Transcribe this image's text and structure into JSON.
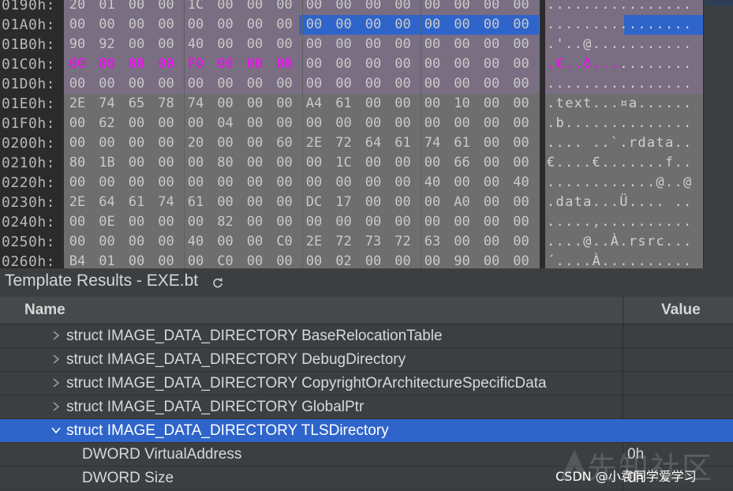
{
  "hex": {
    "rows": [
      {
        "addr": "0190h:",
        "bytes": [
          "20",
          "01",
          "00",
          "00",
          "1C",
          "00",
          "00",
          "00",
          "00",
          "00",
          "00",
          "00",
          "00",
          "00",
          "00",
          "00"
        ],
        "ascii": "................",
        "hl_bytes": [],
        "hl_ascii": 0,
        "bg": "#2b2b2b"
      },
      {
        "addr": "01A0h:",
        "bytes": [
          "00",
          "00",
          "00",
          "00",
          "00",
          "00",
          "00",
          "00",
          "00",
          "00",
          "00",
          "00",
          "00",
          "00",
          "00",
          "00"
        ],
        "ascii": "................",
        "hl_bytes": [
          8,
          9,
          10,
          11,
          12,
          13,
          14,
          15
        ],
        "hl_ascii": 8,
        "bg": "#7a6e82"
      },
      {
        "addr": "01B0h:",
        "bytes": [
          "90",
          "92",
          "00",
          "00",
          "40",
          "00",
          "00",
          "00",
          "00",
          "00",
          "00",
          "00",
          "00",
          "00",
          "00",
          "00"
        ],
        "ascii": ".'..@...........",
        "hl_bytes": [],
        "hl_ascii": 0,
        "bg": "#7a6e82"
      },
      {
        "addr": "01C0h:",
        "bytes": [
          "00",
          "80",
          "00",
          "00",
          "F0",
          "00",
          "00",
          "00",
          "00",
          "00",
          "00",
          "00",
          "00",
          "00",
          "00",
          "00"
        ],
        "ascii": ".€..ð...........",
        "hl_bytes": [],
        "hl_ascii": 0,
        "bg": "#7a6e82",
        "magenta": [
          0,
          1,
          2,
          3,
          4,
          5,
          6,
          7
        ],
        "magenta_ascii": 8
      },
      {
        "addr": "01D0h:",
        "bytes": [
          "00",
          "00",
          "00",
          "00",
          "00",
          "00",
          "00",
          "00",
          "00",
          "00",
          "00",
          "00",
          "00",
          "00",
          "00",
          "00"
        ],
        "ascii": "................",
        "hl_bytes": [],
        "hl_ascii": 0,
        "bg": "#7a6e82"
      },
      {
        "addr": "01E0h:",
        "bytes": [
          "2E",
          "74",
          "65",
          "78",
          "74",
          "00",
          "00",
          "00",
          "A4",
          "61",
          "00",
          "00",
          "00",
          "10",
          "00",
          "00"
        ],
        "ascii": ".text...¤a......",
        "hl_bytes": [],
        "hl_ascii": 0,
        "bg": "#6e6e6e"
      },
      {
        "addr": "01F0h:",
        "bytes": [
          "00",
          "62",
          "00",
          "00",
          "00",
          "04",
          "00",
          "00",
          "00",
          "00",
          "00",
          "00",
          "00",
          "00",
          "00",
          "00"
        ],
        "ascii": ".b..............",
        "hl_bytes": [],
        "hl_ascii": 0,
        "bg": "#6e6e6e"
      },
      {
        "addr": "0200h:",
        "bytes": [
          "00",
          "00",
          "00",
          "00",
          "20",
          "00",
          "00",
          "60",
          "2E",
          "72",
          "64",
          "61",
          "74",
          "61",
          "00",
          "00"
        ],
        "ascii": ".... ..`.rdata..",
        "hl_bytes": [],
        "hl_ascii": 0,
        "bg": "#6e6e6e"
      },
      {
        "addr": "0210h:",
        "bytes": [
          "80",
          "1B",
          "00",
          "00",
          "00",
          "80",
          "00",
          "00",
          "00",
          "1C",
          "00",
          "00",
          "00",
          "66",
          "00",
          "00"
        ],
        "ascii": "€....€.......f..",
        "hl_bytes": [],
        "hl_ascii": 0,
        "bg": "#6e6e6e"
      },
      {
        "addr": "0220h:",
        "bytes": [
          "00",
          "00",
          "00",
          "00",
          "00",
          "00",
          "00",
          "00",
          "00",
          "00",
          "00",
          "00",
          "40",
          "00",
          "00",
          "40"
        ],
        "ascii": "............@..@",
        "hl_bytes": [],
        "hl_ascii": 0,
        "bg": "#6e6e6e"
      },
      {
        "addr": "0230h:",
        "bytes": [
          "2E",
          "64",
          "61",
          "74",
          "61",
          "00",
          "00",
          "00",
          "DC",
          "17",
          "00",
          "00",
          "00",
          "A0",
          "00",
          "00"
        ],
        "ascii": ".data...Ü.... ..",
        "hl_bytes": [],
        "hl_ascii": 0,
        "bg": "#6e6e6e"
      },
      {
        "addr": "0240h:",
        "bytes": [
          "00",
          "0E",
          "00",
          "00",
          "00",
          "82",
          "00",
          "00",
          "00",
          "00",
          "00",
          "00",
          "00",
          "00",
          "00",
          "00"
        ],
        "ascii": ".....,..........",
        "hl_bytes": [],
        "hl_ascii": 0,
        "bg": "#6e6e6e"
      },
      {
        "addr": "0250h:",
        "bytes": [
          "00",
          "00",
          "00",
          "00",
          "40",
          "00",
          "00",
          "C0",
          "2E",
          "72",
          "73",
          "72",
          "63",
          "00",
          "00",
          "00"
        ],
        "ascii": "....@..À.rsrc...",
        "hl_bytes": [],
        "hl_ascii": 0,
        "bg": "#6e6e6e"
      },
      {
        "addr": "0260h:",
        "bytes": [
          "B4",
          "01",
          "00",
          "00",
          "00",
          "C0",
          "00",
          "00",
          "00",
          "02",
          "00",
          "00",
          "00",
          "90",
          "00",
          "00"
        ],
        "ascii": "´....À..........",
        "hl_bytes": [],
        "hl_ascii": 0,
        "bg": "#6e6e6e"
      }
    ],
    "colors": {
      "selection": "#2f65ca",
      "magenta": "#ff00ff",
      "struct_bg": "#7a6e82",
      "gray_bg": "#6e6e6e"
    }
  },
  "template_results": {
    "title": "Template Results - EXE.bt",
    "refresh_icon": "refresh-icon",
    "columns": {
      "name": "Name",
      "value": "Value"
    },
    "rows": [
      {
        "label": "struct IMAGE_DATA_DIRECTORY BaseRelocationTable",
        "value": "",
        "expanded": false,
        "indent": 1,
        "selected": false
      },
      {
        "label": "struct IMAGE_DATA_DIRECTORY DebugDirectory",
        "value": "",
        "expanded": false,
        "indent": 1,
        "selected": false
      },
      {
        "label": "struct IMAGE_DATA_DIRECTORY CopyrightOrArchitectureSpecificData",
        "value": "",
        "expanded": false,
        "indent": 1,
        "selected": false
      },
      {
        "label": "struct IMAGE_DATA_DIRECTORY GlobalPtr",
        "value": "",
        "expanded": false,
        "indent": 1,
        "selected": false
      },
      {
        "label": "struct IMAGE_DATA_DIRECTORY TLSDirectory",
        "value": "",
        "expanded": true,
        "indent": 1,
        "selected": true
      },
      {
        "label": "DWORD VirtualAddress",
        "value": "0h",
        "expanded": null,
        "indent": 2,
        "selected": false
      },
      {
        "label": "DWORD Size",
        "value": "0h",
        "expanded": null,
        "indent": 2,
        "selected": false
      }
    ]
  },
  "watermark": {
    "big": "先知社区",
    "small": "CSDN @小袁同学爱学习"
  }
}
